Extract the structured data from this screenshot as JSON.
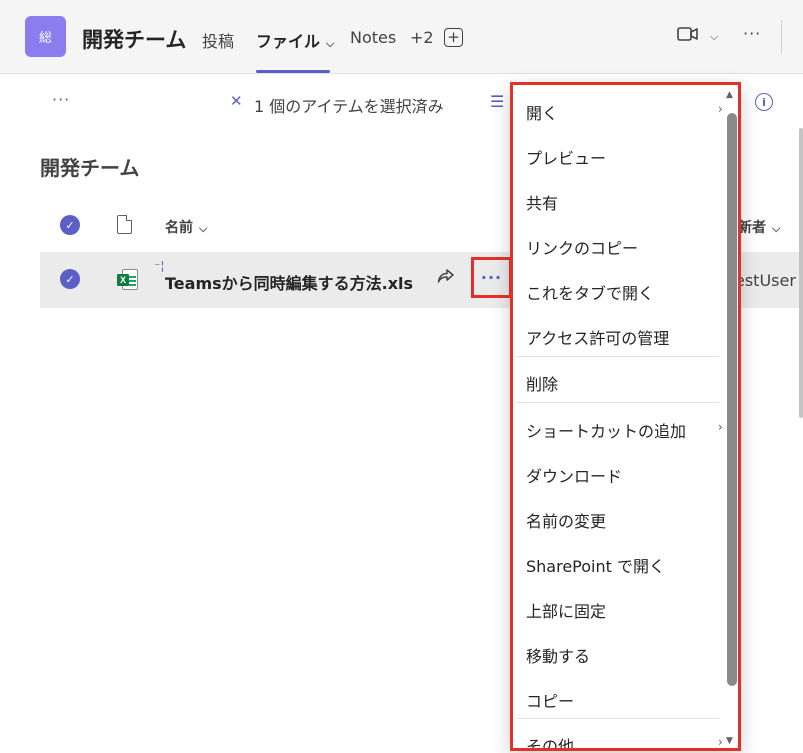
{
  "header": {
    "avatar_text": "総",
    "team_name": "開発チーム",
    "tabs": [
      {
        "label": "投稿"
      },
      {
        "label": "ファイル"
      },
      {
        "label": "Notes"
      },
      {
        "label": "+2"
      }
    ],
    "add_tab_symbol": "+",
    "more_symbol": "···"
  },
  "command_bar": {
    "more_symbol": "···",
    "close_symbol": "✕",
    "selected_text": "1 個のアイテムを選択済み"
  },
  "library": {
    "title": "開発チーム",
    "columns": {
      "name": "名前",
      "modified_by": "新者"
    },
    "files": [
      {
        "name": "Teamsから同時編集する方法.xls",
        "modified_by": "estUser",
        "selected": true
      }
    ]
  },
  "context_menu": {
    "items": [
      {
        "label": "開く",
        "has_submenu": true
      },
      {
        "label": "プレビュー"
      },
      {
        "label": "共有"
      },
      {
        "label": "リンクのコピー"
      },
      {
        "label": "これをタブで開く"
      },
      {
        "label": "アクセス許可の管理"
      },
      {
        "label": "削除"
      },
      {
        "label": "ショートカットの追加",
        "has_submenu": true
      },
      {
        "label": "ダウンロード"
      },
      {
        "label": "名前の変更"
      },
      {
        "label": "SharePoint で開く"
      },
      {
        "label": "上部に固定"
      },
      {
        "label": "移動する"
      },
      {
        "label": "コピー"
      },
      {
        "label": "その他",
        "has_submenu": true
      }
    ]
  },
  "colors": {
    "accent": "#5b5fc7",
    "avatar_bg": "#8b7cf0",
    "highlight_border": "#e5302a",
    "excel_green": "#107c41"
  }
}
